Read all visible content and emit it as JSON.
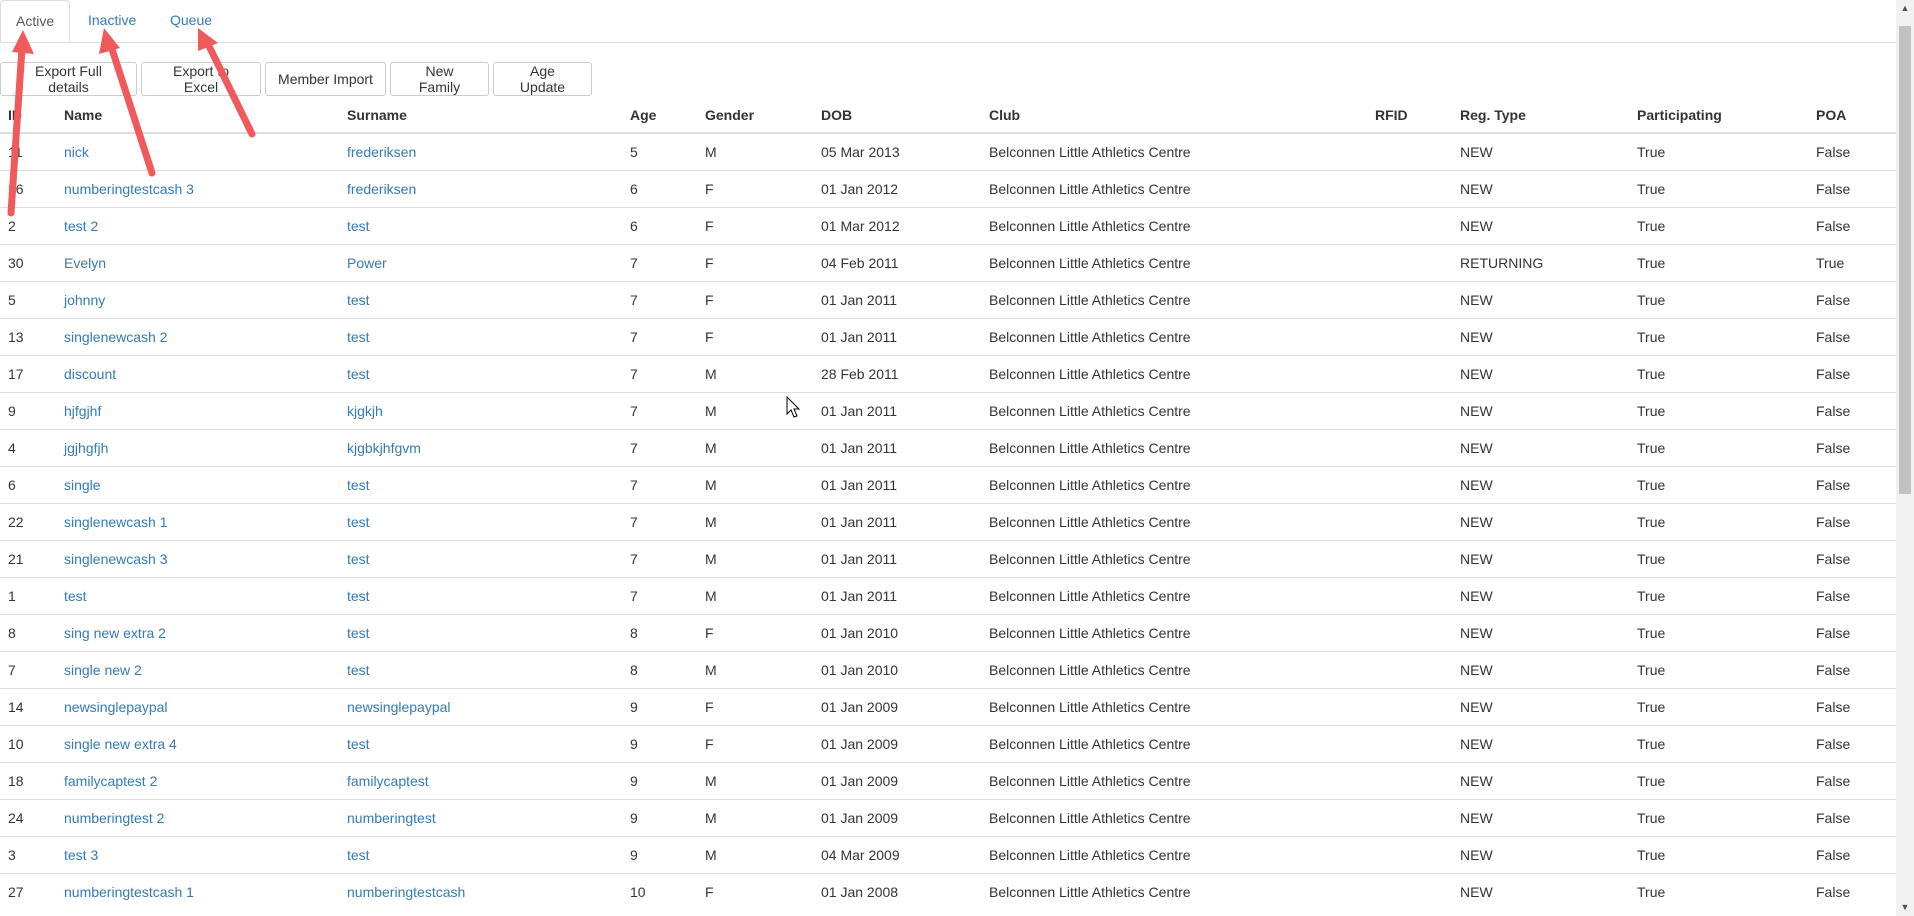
{
  "tabs": [
    {
      "label": "Active",
      "active": true
    },
    {
      "label": "Inactive",
      "active": false
    },
    {
      "label": "Queue",
      "active": false
    }
  ],
  "toolbar": {
    "export_full": "Export Full details",
    "export_excel": "Export to Excel",
    "member_import": "Member Import",
    "new_family": "New Family",
    "age_update": "Age Update"
  },
  "table": {
    "headers": [
      "ID",
      "Name",
      "Surname",
      "Age",
      "Gender",
      "DOB",
      "Club",
      "RFID",
      "Reg. Type",
      "Participating",
      "POA"
    ],
    "rows": [
      [
        "11",
        "nick",
        "frederiksen",
        "5",
        "M",
        "05 Mar 2013",
        "Belconnen Little Athletics Centre",
        "",
        "NEW",
        "True",
        "False"
      ],
      [
        "26",
        "numberingtestcash 3",
        "frederiksen",
        "6",
        "F",
        "01 Jan 2012",
        "Belconnen Little Athletics Centre",
        "",
        "NEW",
        "True",
        "False"
      ],
      [
        "2",
        "test 2",
        "test",
        "6",
        "F",
        "01 Mar 2012",
        "Belconnen Little Athletics Centre",
        "",
        "NEW",
        "True",
        "False"
      ],
      [
        "30",
        "Evelyn",
        "Power",
        "7",
        "F",
        "04 Feb 2011",
        "Belconnen Little Athletics Centre",
        "",
        "RETURNING",
        "True",
        "True"
      ],
      [
        "5",
        "johnny",
        "test",
        "7",
        "F",
        "01 Jan 2011",
        "Belconnen Little Athletics Centre",
        "",
        "NEW",
        "True",
        "False"
      ],
      [
        "13",
        "singlenewcash 2",
        "test",
        "7",
        "F",
        "01 Jan 2011",
        "Belconnen Little Athletics Centre",
        "",
        "NEW",
        "True",
        "False"
      ],
      [
        "17",
        "discount",
        "test",
        "7",
        "M",
        "28 Feb 2011",
        "Belconnen Little Athletics Centre",
        "",
        "NEW",
        "True",
        "False"
      ],
      [
        "9",
        "hjfgjhf",
        "kjgkjh",
        "7",
        "M",
        "01 Jan 2011",
        "Belconnen Little Athletics Centre",
        "",
        "NEW",
        "True",
        "False"
      ],
      [
        "4",
        "jgjhgfjh",
        "kjgbkjhfgvm",
        "7",
        "M",
        "01 Jan 2011",
        "Belconnen Little Athletics Centre",
        "",
        "NEW",
        "True",
        "False"
      ],
      [
        "6",
        "single",
        "test",
        "7",
        "M",
        "01 Jan 2011",
        "Belconnen Little Athletics Centre",
        "",
        "NEW",
        "True",
        "False"
      ],
      [
        "22",
        "singlenewcash 1",
        "test",
        "7",
        "M",
        "01 Jan 2011",
        "Belconnen Little Athletics Centre",
        "",
        "NEW",
        "True",
        "False"
      ],
      [
        "21",
        "singlenewcash 3",
        "test",
        "7",
        "M",
        "01 Jan 2011",
        "Belconnen Little Athletics Centre",
        "",
        "NEW",
        "True",
        "False"
      ],
      [
        "1",
        "test",
        "test",
        "7",
        "M",
        "01 Jan 2011",
        "Belconnen Little Athletics Centre",
        "",
        "NEW",
        "True",
        "False"
      ],
      [
        "8",
        "sing new extra 2",
        "test",
        "8",
        "F",
        "01 Jan 2010",
        "Belconnen Little Athletics Centre",
        "",
        "NEW",
        "True",
        "False"
      ],
      [
        "7",
        "single new 2",
        "test",
        "8",
        "M",
        "01 Jan 2010",
        "Belconnen Little Athletics Centre",
        "",
        "NEW",
        "True",
        "False"
      ],
      [
        "14",
        "newsinglepaypal",
        "newsinglepaypal",
        "9",
        "F",
        "01 Jan 2009",
        "Belconnen Little Athletics Centre",
        "",
        "NEW",
        "True",
        "False"
      ],
      [
        "10",
        "single new extra 4",
        "test",
        "9",
        "F",
        "01 Jan 2009",
        "Belconnen Little Athletics Centre",
        "",
        "NEW",
        "True",
        "False"
      ],
      [
        "18",
        "familycaptest 2",
        "familycaptest",
        "9",
        "M",
        "01 Jan 2009",
        "Belconnen Little Athletics Centre",
        "",
        "NEW",
        "True",
        "False"
      ],
      [
        "24",
        "numberingtest 2",
        "numberingtest",
        "9",
        "M",
        "01 Jan 2009",
        "Belconnen Little Athletics Centre",
        "",
        "NEW",
        "True",
        "False"
      ],
      [
        "3",
        "test 3",
        "test",
        "9",
        "M",
        "04 Mar 2009",
        "Belconnen Little Athletics Centre",
        "",
        "NEW",
        "True",
        "False"
      ],
      [
        "27",
        "numberingtestcash 1",
        "numberingtestcash",
        "10",
        "F",
        "01 Jan 2008",
        "Belconnen Little Athletics Centre",
        "",
        "NEW",
        "True",
        "False"
      ]
    ]
  },
  "colors": {
    "link": "#337ab7",
    "annotation_arrow": "#f05a5a",
    "border": "#dddddd"
  }
}
